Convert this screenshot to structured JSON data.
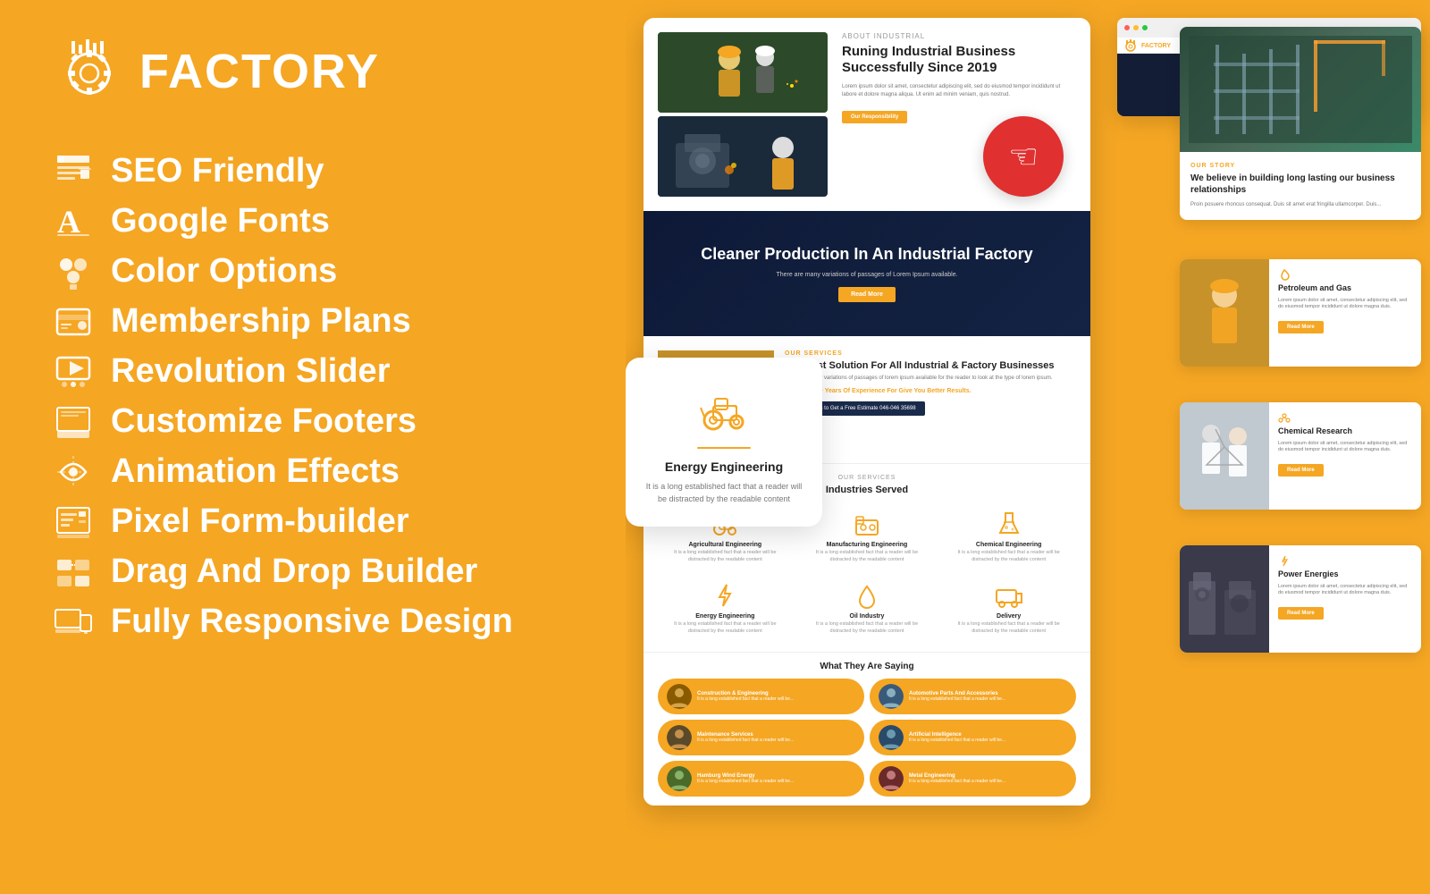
{
  "brand": {
    "name": "FACTORY",
    "icon_alt": "factory-icon"
  },
  "features": [
    {
      "id": "seo",
      "text": "SEO Friendly",
      "icon": "seo-icon"
    },
    {
      "id": "fonts",
      "text": "Google Fonts",
      "icon": "fonts-icon"
    },
    {
      "id": "color",
      "text": "Color Options",
      "icon": "color-icon"
    },
    {
      "id": "membership",
      "text": "Membership Plans",
      "icon": "membership-icon"
    },
    {
      "id": "slider",
      "text": "Revolution Slider",
      "icon": "slider-icon"
    },
    {
      "id": "footers",
      "text": "Customize Footers",
      "icon": "footers-icon"
    },
    {
      "id": "animation",
      "text": "Animation Effects",
      "icon": "animation-icon"
    },
    {
      "id": "pixel",
      "text": "Pixel Form-builder",
      "icon": "pixel-icon"
    },
    {
      "id": "drag",
      "text": "Drag And Drop Builder",
      "icon": "drag-icon"
    },
    {
      "id": "responsive",
      "text": "Fully Responsive Design",
      "icon": "responsive-icon"
    }
  ],
  "screenshots": {
    "about_label": "ABOUT INDUSTRIAL",
    "about_title": "Runing Industrial Business Successfully Since 2019",
    "about_desc": "Lorem ipsum dolor sit amet, consectetur adipiscing elit, sed do eiusmod tempor incididunt ut labore et dolore magna aliqua. Ut enim ad minim veniam, quis nostrud.",
    "about_btn": "Our Responsibility",
    "hero_title": "Cleaner Production In An Industrial Factory",
    "hero_desc": "There are many variations of passages of Lorem Ipsum available.",
    "hero_btn": "Read More",
    "service_label": "OUR SERVICES",
    "service_title": "The Best Solution For All Industrial & Factory Businesses",
    "service_desc": "There are many variations of passages of lorem ipsum available for the reader to look at the type of lorem ipsum.",
    "service_highlight": "We Have 25+ Years Of Experience For Give You Better Results.",
    "service_cta": "Let's Call us to Get a Free Estimate 046-046 35698",
    "industries_label": "OUR SERVICES",
    "industries_title": "Industries Served",
    "industries": [
      {
        "name": "Agricultural Engineering",
        "desc": "It is a long established fact that a reader will be distracted by the readable content"
      },
      {
        "name": "Manufacturing Engineering",
        "desc": "It is a long established fact that a reader will be distracted by the readable content"
      },
      {
        "name": "Chemical Engineering",
        "desc": "It is a long established fact that a reader will be distracted by the readable content"
      },
      {
        "name": "Energy Engineering",
        "desc": "It is a long established fact that a reader will be distracted by the readable content"
      },
      {
        "name": "Oil Industry",
        "desc": "It is a long established fact that a reader will be distracted by the readable content"
      },
      {
        "name": "Delivery",
        "desc": "It is a long established fact that a reader will be distracted by the readable content"
      }
    ],
    "testimonials_title": "What They Are Saying",
    "testimonials": [
      {
        "name": "Construction & Engineering",
        "desc": "It is a long established fact that a reader will be..."
      },
      {
        "name": "Automotive Parts And Accessories",
        "desc": "It is a long established fact that a reader will be..."
      },
      {
        "name": "Maintenance Services",
        "desc": "It is a long established fact that a reader will be..."
      },
      {
        "name": "Artificial Intelligence",
        "desc": "It is a long established fact that a reader will be..."
      },
      {
        "name": "Hamburg Wind Energy",
        "desc": "It is a long established fact that a reader will be..."
      },
      {
        "name": "Metal Engineering",
        "desc": "It is a long established fact that a reader will be..."
      }
    ]
  },
  "energy_card": {
    "title": "Energy Engineering",
    "desc": "It is a long established fact that a reader will be distracted by the readable content",
    "icon": "tractor-icon"
  },
  "side_cards": [
    {
      "badge": "OUR STORY",
      "title": "We believe in building long lasting our business relationships",
      "desc": "Proin posuere rhoncus consequat. Duis sit amet erat fringilla ullamcorper. Duis..."
    },
    {
      "badge": "PETROLEUM",
      "title": "Petroleum and Gas",
      "desc": "Lorem ipsum dolor sit amet, consectetur adipiscing elit, sed do eiusmod tempor incididunt ut dolore magna duis."
    },
    {
      "badge": "CHEMICAL",
      "title": "Chemical Research",
      "desc": "Lorem ipsum dolor sit amet, consectetur adipiscing elit, sed do eiusmod tempor incididunt ut dolore magna duis."
    },
    {
      "badge": "ENERGY",
      "title": "Power Energies",
      "desc": "Lorem ipsum dolor sit amet, consectetur adipiscing elit, sed do eiusmod tempor incididunt ut dolore magna duis."
    }
  ],
  "read_more_label": "Read More"
}
